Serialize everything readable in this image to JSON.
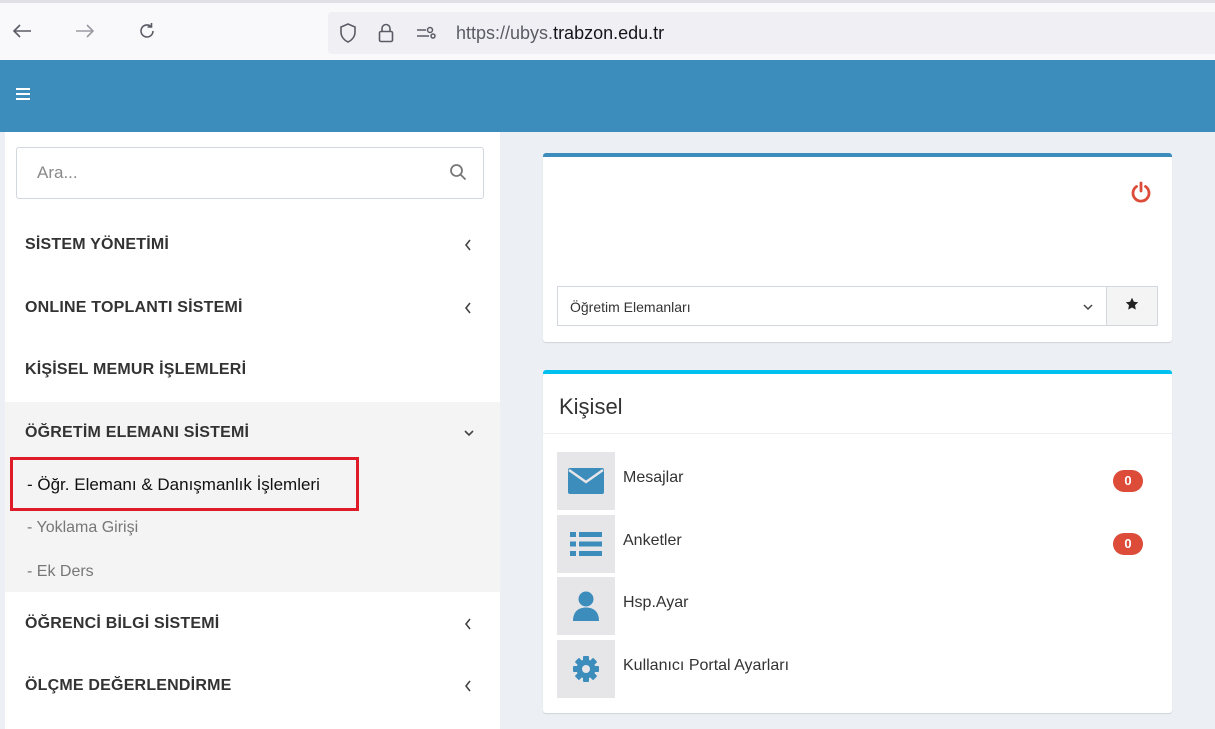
{
  "browser": {
    "url_prefix": "https://ubys.",
    "url_domain": "trabzon.edu.tr",
    "icons": [
      "back-arrow-icon",
      "forward-arrow-icon",
      "reload-icon",
      "shield-icon",
      "lock-icon",
      "permissions-icon"
    ]
  },
  "header": {
    "color": "#3c8dbc",
    "menu_icon": "hamburger-icon"
  },
  "sidebar": {
    "search": {
      "placeholder": "Ara...",
      "value": ""
    },
    "items": [
      {
        "label": "SİSTEM YÖNETİMİ",
        "state": "collapsed"
      },
      {
        "label": "ONLINE TOPLANTI SİSTEMİ",
        "state": "collapsed"
      },
      {
        "label": "KİŞİSEL MEMUR İŞLEMLERİ",
        "state": "none"
      },
      {
        "label": "ÖĞRETİM ELEMANI SİSTEMİ",
        "state": "expanded"
      },
      {
        "label": "ÖĞRENCİ BİLGİ SİSTEMİ",
        "state": "collapsed"
      },
      {
        "label": "ÖLÇME DEĞERLENDİRME",
        "state": "collapsed"
      }
    ],
    "subitems": [
      {
        "label": "- Öğr. Elemanı & Danışmanlık İşlemleri",
        "active": true
      },
      {
        "label": "- Yoklama Girişi",
        "active": false
      },
      {
        "label": "- Ek Ders",
        "active": false
      }
    ]
  },
  "top_panel": {
    "select_value": "Öğretim Elemanları",
    "power_color": "#dd4b39"
  },
  "personal": {
    "title": "Kişisel",
    "rows": [
      {
        "label": "Mesajlar",
        "icon": "envelope-icon",
        "badge": "0"
      },
      {
        "label": "Anketler",
        "icon": "list-icon",
        "badge": "0"
      },
      {
        "label": "Hsp.Ayar",
        "icon": "user-icon"
      },
      {
        "label": "Kullanıcı Portal Ayarları",
        "icon": "gear-icon"
      }
    ],
    "icon_color": "#3c8dbc",
    "badge_color": "#dd4b39"
  }
}
